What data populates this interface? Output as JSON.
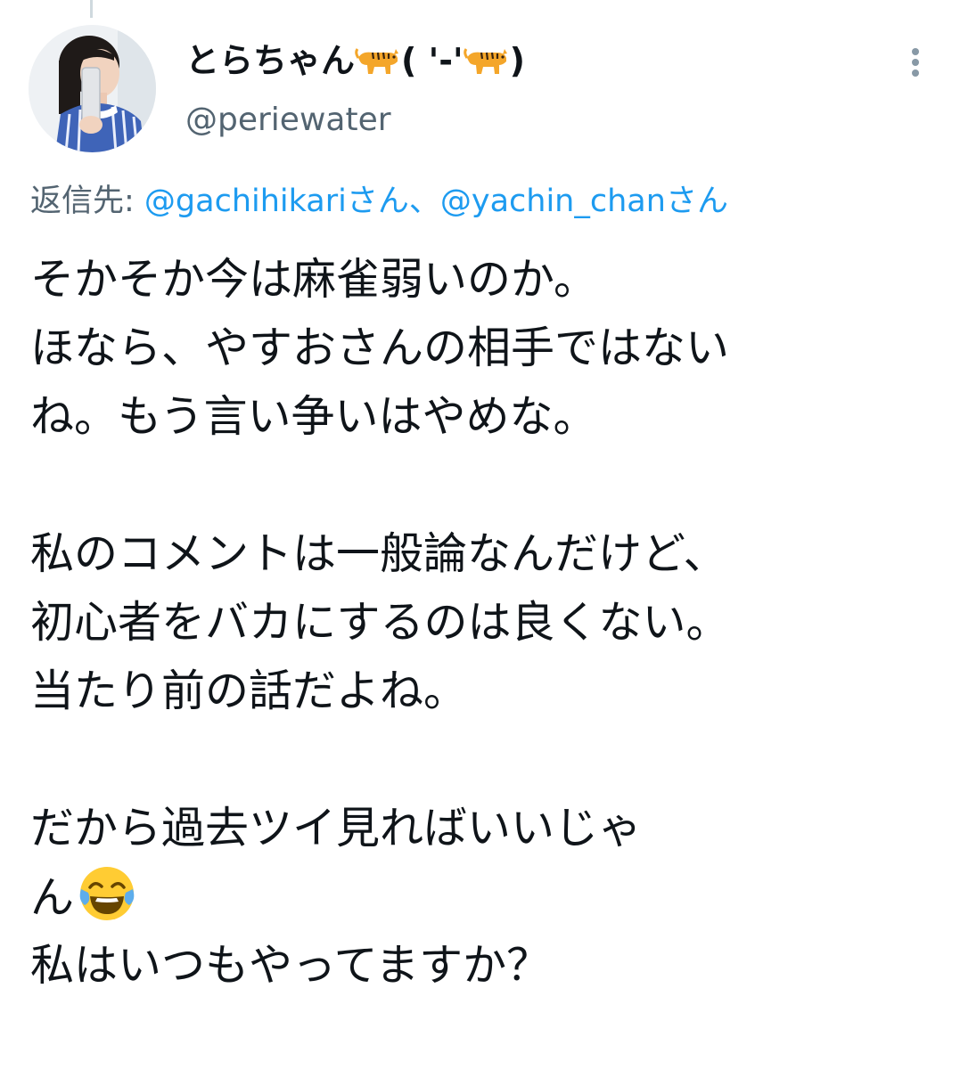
{
  "author": {
    "name_text": "とらちゃん",
    "name_middle": "( '-'",
    "name_end": ")",
    "handle": "@periewater",
    "avatar_icon": "person-avatar-photo",
    "name_emoji": "tiger-icon"
  },
  "reply": {
    "prefix": "返信先: ",
    "mention1": "@gachihikari",
    "san1": "さん、",
    "mention2": "@yachin_chan",
    "san2": "さん"
  },
  "tweet": {
    "line1": "そかそか今は麻雀弱いのか。",
    "line2": "ほなら、やすおさんの相手ではない",
    "line3": "ね。もう言い争いはやめな。",
    "line4": "私のコメントは一般論なんだけど、",
    "line5": "初心者をバカにするのは良くない。",
    "line6": "当たり前の話だよね。",
    "line7": "だから過去ツイ見ればいいじゃ",
    "line8": "ん",
    "line9": "私はいつもやってますか？",
    "emoji": "tears-of-joy-emoji"
  },
  "colors": {
    "text": "#0f1419",
    "secondary": "#536471",
    "link": "#1d9bf0"
  },
  "more_icon": "more-options-icon"
}
